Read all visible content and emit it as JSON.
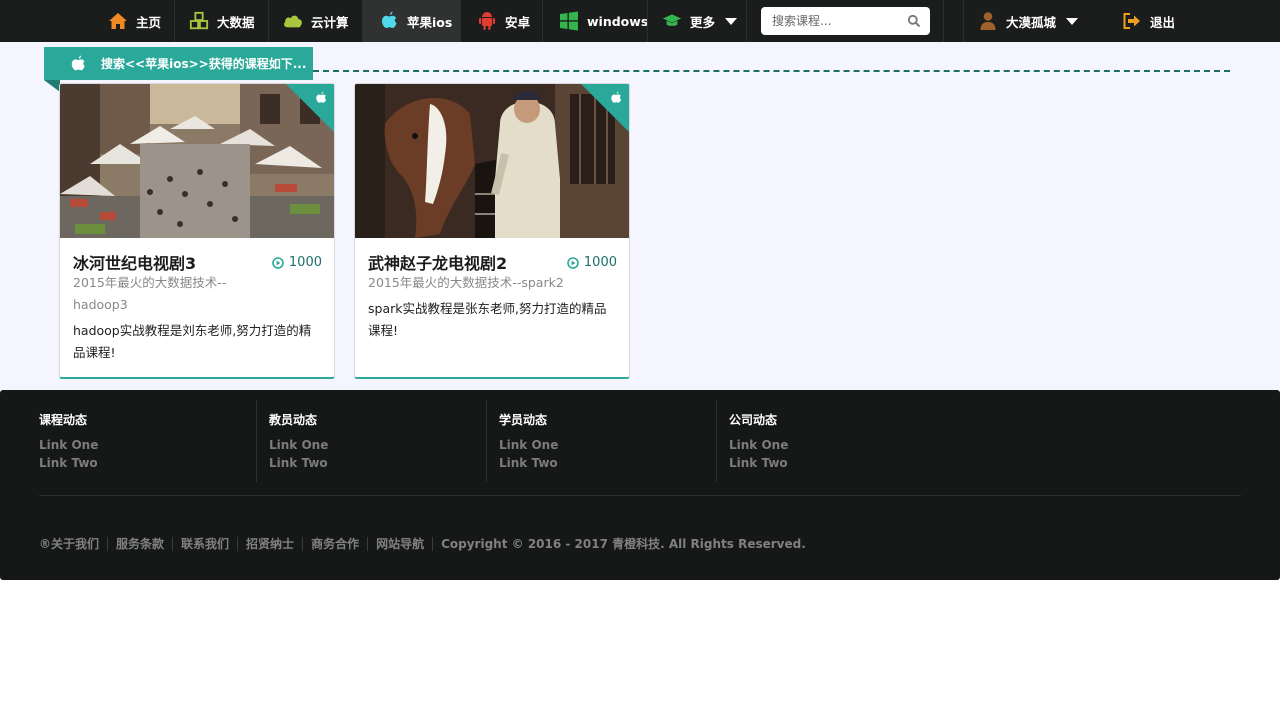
{
  "nav": {
    "items": [
      {
        "label": "主页",
        "icon": "home-icon"
      },
      {
        "label": "大数据",
        "icon": "cubes-icon"
      },
      {
        "label": "云计算",
        "icon": "cloud-icon"
      },
      {
        "label": "苹果ios",
        "icon": "apple-icon",
        "active": true
      },
      {
        "label": "安卓",
        "icon": "android-icon"
      },
      {
        "label": "windows",
        "icon": "windows-icon"
      },
      {
        "label": "更多",
        "icon": "graduation-cap-icon"
      }
    ],
    "search_placeholder": "搜索课程...",
    "user_name": "大漠孤城",
    "logout_label": "退出"
  },
  "main": {
    "banner": "搜索<<苹果ios>>获得的课程如下...",
    "courses": [
      {
        "title": "冰河世纪电视剧3",
        "plays": "1000",
        "subtitle": "2015年最火的大数据技术--hadoop3",
        "description": "hadoop实战教程是刘东老师,努力打造的精品课程!"
      },
      {
        "title": "武神赵子龙电视剧2",
        "plays": "1000",
        "subtitle": "2015年最火的大数据技术--spark2",
        "description": "spark实战教程是张东老师,努力打造的精品课程!"
      }
    ]
  },
  "footer": {
    "columns": [
      {
        "title": "课程动态",
        "links": [
          "Link One",
          "Link Two"
        ]
      },
      {
        "title": "教员动态",
        "links": [
          "Link One",
          "Link Two"
        ]
      },
      {
        "title": "学员动态",
        "links": [
          "Link One",
          "Link Two"
        ]
      },
      {
        "title": "公司动态",
        "links": [
          "Link One",
          "Link Two"
        ]
      }
    ],
    "bottom_links": [
      "®关于我们",
      "服务条款",
      "联系我们",
      "招贤纳士",
      "商务合作",
      "网站导航"
    ],
    "copyright": "Copyright © 2016 - 2017 青橙科技. All Rights Reserved."
  },
  "colors": {
    "nav_bg": "#1b1c1c",
    "accent": "#2aa99a",
    "content_bg": "#f4f5fe",
    "footer_bg": "#161818"
  }
}
